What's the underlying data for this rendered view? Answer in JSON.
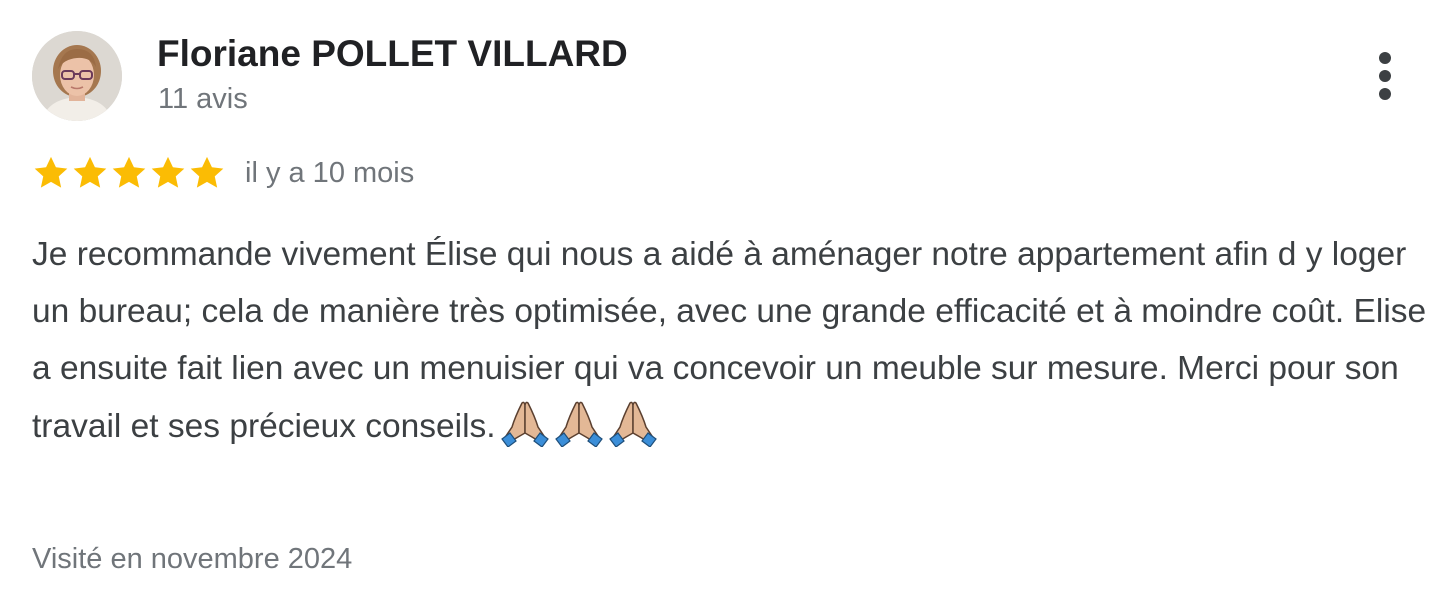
{
  "reviewer": {
    "name": "Floriane POLLET VILLARD",
    "review_count": "11 avis",
    "avatar_icon": "profile-photo"
  },
  "rating": {
    "stars": 5,
    "max_stars": 5,
    "star_color": "#fbbc04",
    "date": "il y a 10 mois"
  },
  "review": {
    "text": "Je recommande vivement Élise qui nous a aidé à aménager notre appartement afin d y loger un bureau; cela de manière très optimisée, avec une grande efficacité et à moindre coût. Elise a ensuite fait lien avec un menuisier qui va concevoir un meuble sur mesure. Merci pour son travail et ses précieux conseils.",
    "emojis": [
      "folded-hands-emoji",
      "folded-hands-emoji",
      "folded-hands-emoji"
    ]
  },
  "visit": {
    "label": "Visité en novembre 2024"
  },
  "actions": {
    "more_icon": "more-vert-icon"
  },
  "colors": {
    "name": "#202124",
    "body_text": "#3c4043",
    "secondary_text": "#70757a",
    "star": "#fbbc04"
  }
}
